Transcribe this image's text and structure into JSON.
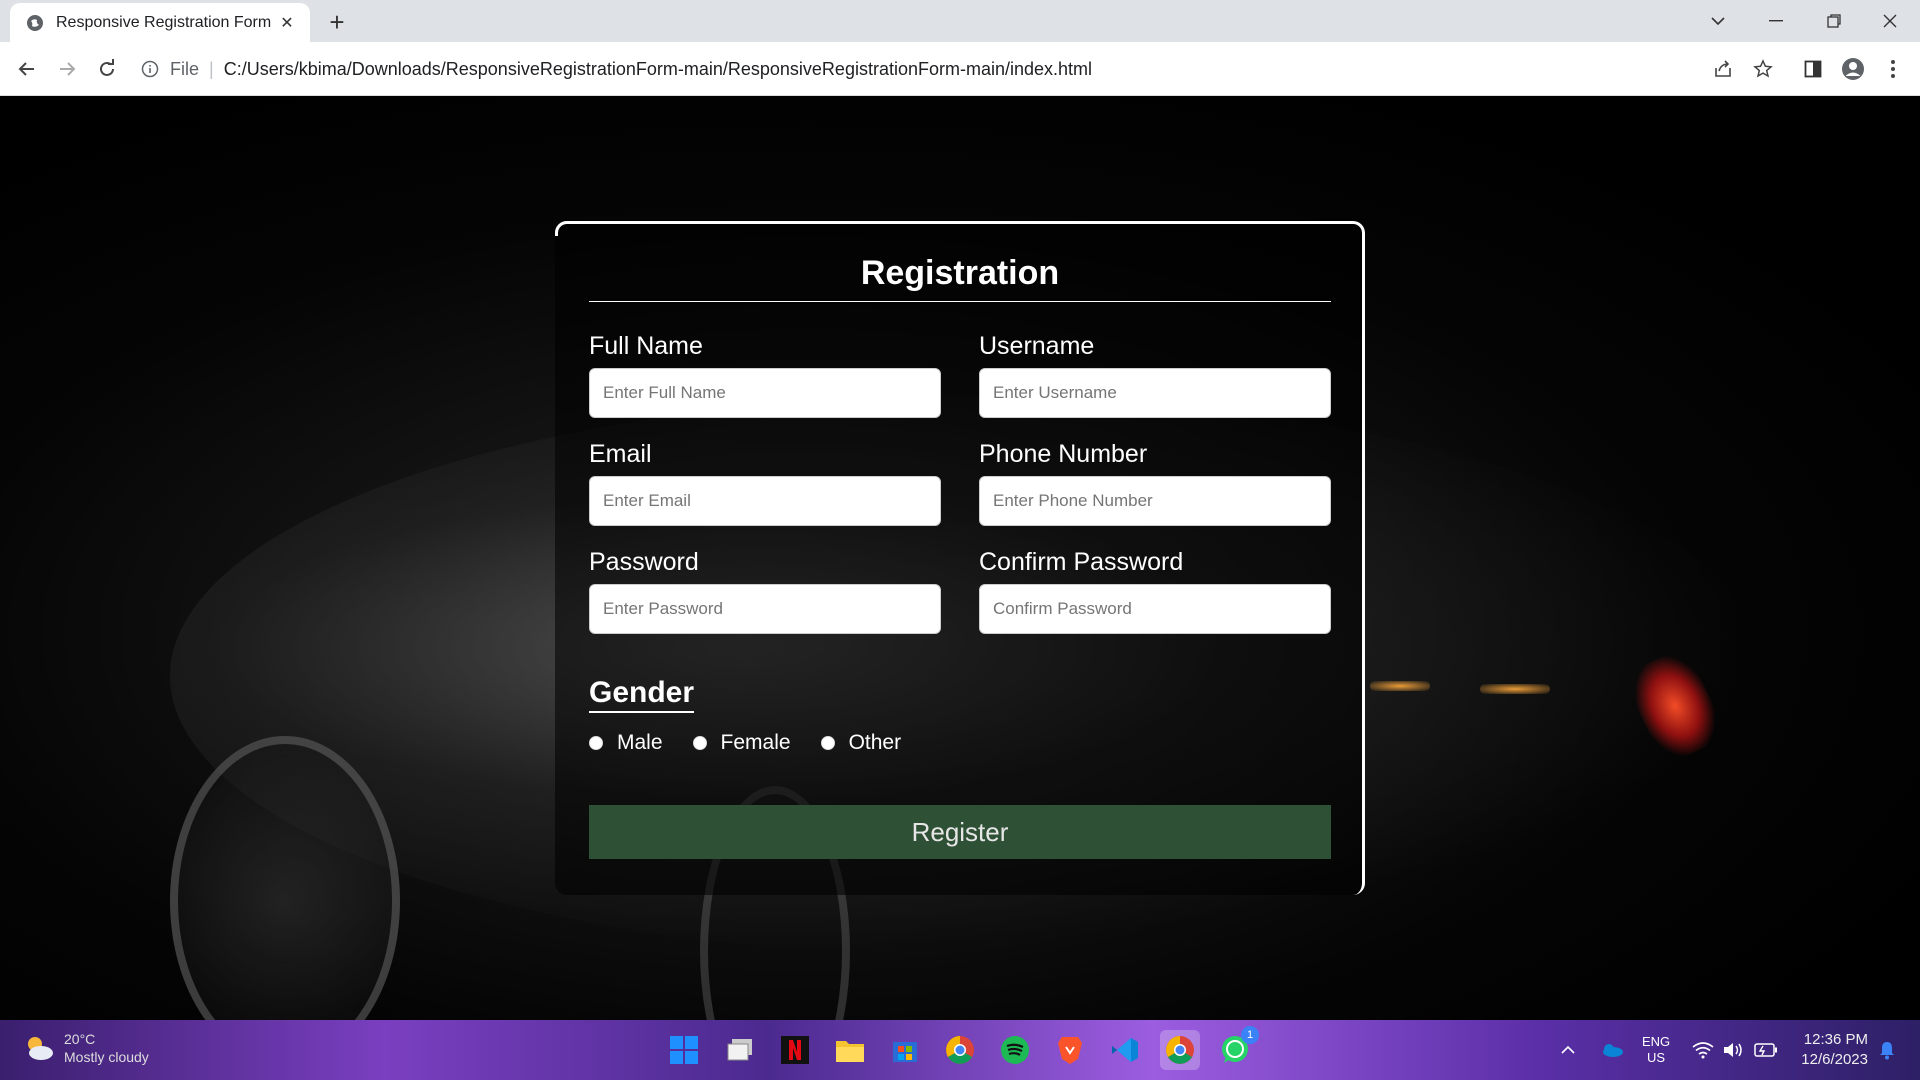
{
  "browser": {
    "tab_title": "Responsive Registration Form",
    "omnibox_scheme": "File",
    "url": "C:/Users/kbima/Downloads/ResponsiveRegistrationForm-main/ResponsiveRegistrationForm-main/index.html"
  },
  "form": {
    "title": "Registration",
    "fields": {
      "full_name": {
        "label": "Full Name",
        "placeholder": "Enter Full Name",
        "value": ""
      },
      "username": {
        "label": "Username",
        "placeholder": "Enter Username",
        "value": ""
      },
      "email": {
        "label": "Email",
        "placeholder": "Enter Email",
        "value": ""
      },
      "phone": {
        "label": "Phone Number",
        "placeholder": "Enter Phone Number",
        "value": ""
      },
      "password": {
        "label": "Password",
        "placeholder": "Enter Password",
        "value": ""
      },
      "confirm_password": {
        "label": "Confirm Password",
        "placeholder": "Confirm Password",
        "value": ""
      }
    },
    "gender": {
      "title": "Gender",
      "options": [
        "Male",
        "Female",
        "Other"
      ]
    },
    "submit_label": "Register",
    "button_color": "#2e5035"
  },
  "taskbar": {
    "weather_temp": "20°C",
    "weather_desc": "Mostly cloudy",
    "lang_primary": "ENG",
    "lang_secondary": "US",
    "time": "12:36 PM",
    "date": "12/6/2023",
    "whatsapp_badge": "1"
  }
}
